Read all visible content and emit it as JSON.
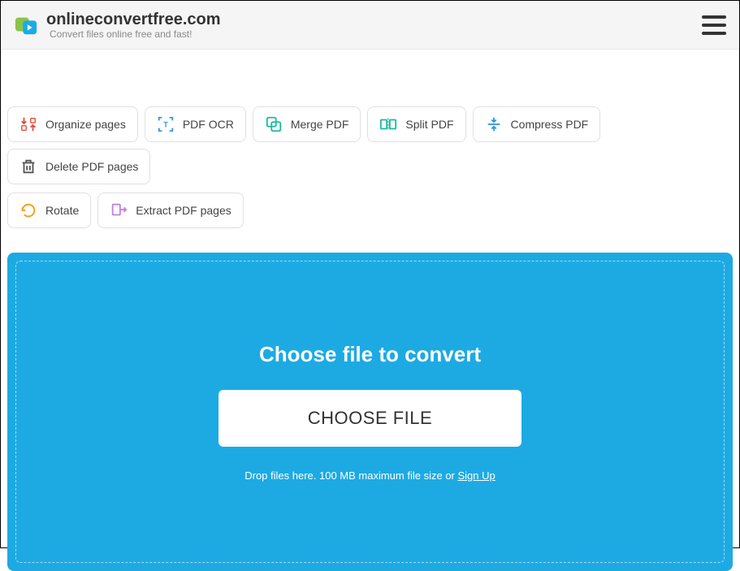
{
  "header": {
    "site_name": "onlineconvertfree.com",
    "tagline": "Convert files online free and fast!"
  },
  "tools": {
    "row1": [
      {
        "label": "Organize pages",
        "icon": "organize"
      },
      {
        "label": "PDF OCR",
        "icon": "ocr"
      },
      {
        "label": "Merge PDF",
        "icon": "merge"
      },
      {
        "label": "Split PDF",
        "icon": "split"
      },
      {
        "label": "Compress PDF",
        "icon": "compress"
      },
      {
        "label": "Delete PDF pages",
        "icon": "delete"
      }
    ],
    "row2": [
      {
        "label": "Rotate",
        "icon": "rotate"
      },
      {
        "label": "Extract PDF pages",
        "icon": "extract"
      }
    ]
  },
  "dropzone": {
    "title": "Choose file to convert",
    "button_label": "CHOOSE FILE",
    "hint_prefix": "Drop files here. 100 MB maximum file size or ",
    "signup_label": "Sign Up"
  }
}
